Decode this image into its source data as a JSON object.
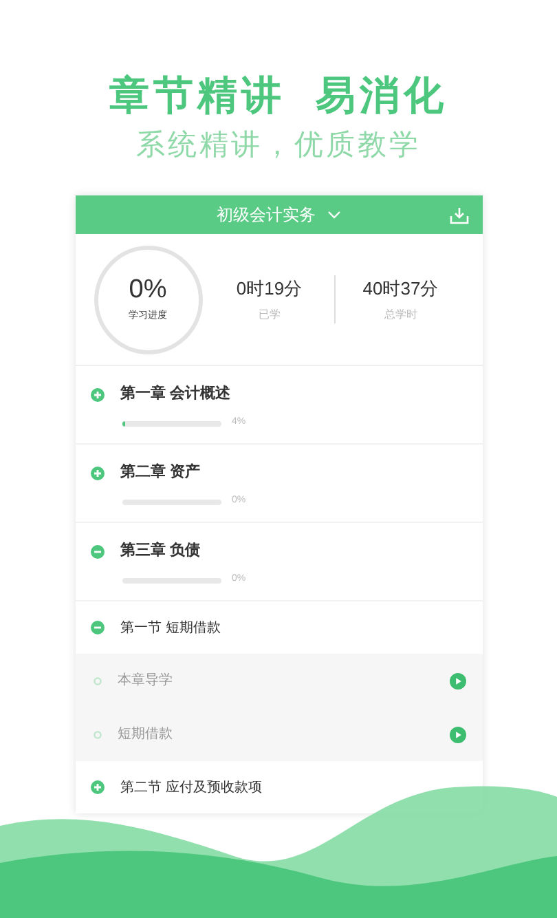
{
  "headline": {
    "title": "章节精讲  易消化",
    "subtitle": "系统精讲，优质教学"
  },
  "course": {
    "title": "初级会计实务",
    "progress": "0%",
    "progress_label": "学习进度",
    "stats": [
      {
        "value": "0时19分",
        "label": "已学"
      },
      {
        "value": "40时37分",
        "label": "总学时"
      }
    ]
  },
  "chapters": [
    {
      "title": "第一章 会计概述",
      "expanded": false,
      "level": 0.04,
      "percent": "4%"
    },
    {
      "title": "第二章 资产",
      "expanded": false,
      "percent": "0%"
    },
    {
      "title": "第三章 负债",
      "expanded": true,
      "percent": "0%",
      "children": [
        {
          "title": "第一节 短期借款",
          "expanded": true,
          "children": [
            {
              "title": "本章导学"
            },
            {
              "title": "短期借款"
            }
          ]
        },
        {
          "title": "第二节 应付及预收款项",
          "expanded": false
        }
      ]
    }
  ]
}
